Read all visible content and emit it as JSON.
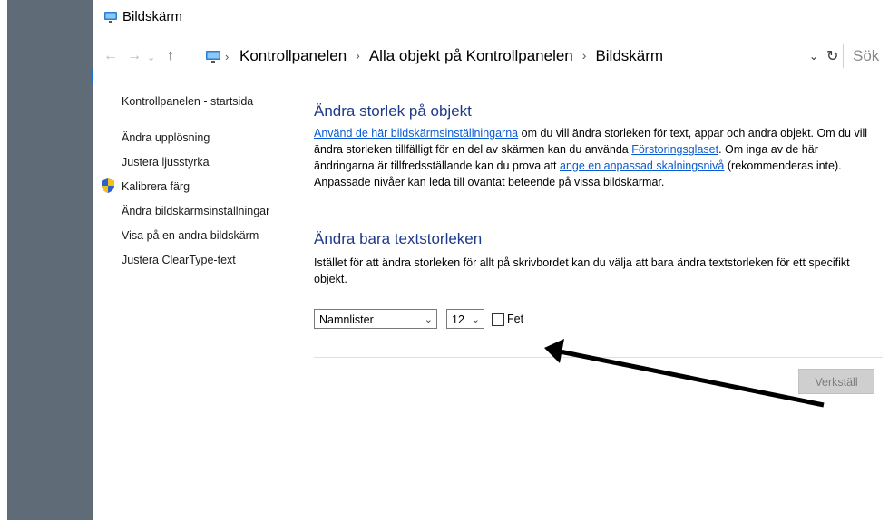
{
  "window": {
    "title": "Bildskärm"
  },
  "address": {
    "crumbs": [
      "Kontrollpanelen",
      "Alla objekt på Kontrollpanelen",
      "Bildskärm"
    ],
    "search_placeholder": "Sök"
  },
  "sidebar": {
    "items": [
      {
        "label": "Kontrollpanelen - startsida"
      },
      {
        "label": "Ändra upplösning"
      },
      {
        "label": "Justera ljusstyrka"
      },
      {
        "label": "Kalibrera färg",
        "icon": "shield-icon"
      },
      {
        "label": "Ändra bildskärmsinställningar"
      },
      {
        "label": "Visa på en andra bildskärm"
      },
      {
        "label": "Justera ClearType-text"
      }
    ]
  },
  "main": {
    "section1": {
      "title": "Ändra storlek på objekt",
      "link1": "Använd de här bildskärmsinställningarna",
      "text1": " om du vill ändra storleken för text, appar och andra objekt. Om du vill ändra storleken tillfälligt för en del av skärmen kan du använda ",
      "link2": "Förstoringsglaset",
      "text2": ". Om inga av de här ändringarna är tillfredsställande kan du prova att ",
      "link3": "ange en anpassad skalningsnivå",
      "text3": " (rekommenderas inte). Anpassade nivåer kan leda till oväntat beteende på vissa bildskärmar."
    },
    "section2": {
      "title": "Ändra bara textstorleken",
      "description": "Istället för att ändra storleken för allt på skrivbordet kan du välja att bara ändra textstorleken för ett specifikt objekt.",
      "element_select": "Namnlister",
      "size_select": "12",
      "bold_label": "Fet",
      "bold_checked": false
    },
    "apply_label": "Verkställ"
  },
  "colors": {
    "heading": "#1e3a8a",
    "link": "#0a5bd1",
    "desktop": "#5f6c78"
  }
}
